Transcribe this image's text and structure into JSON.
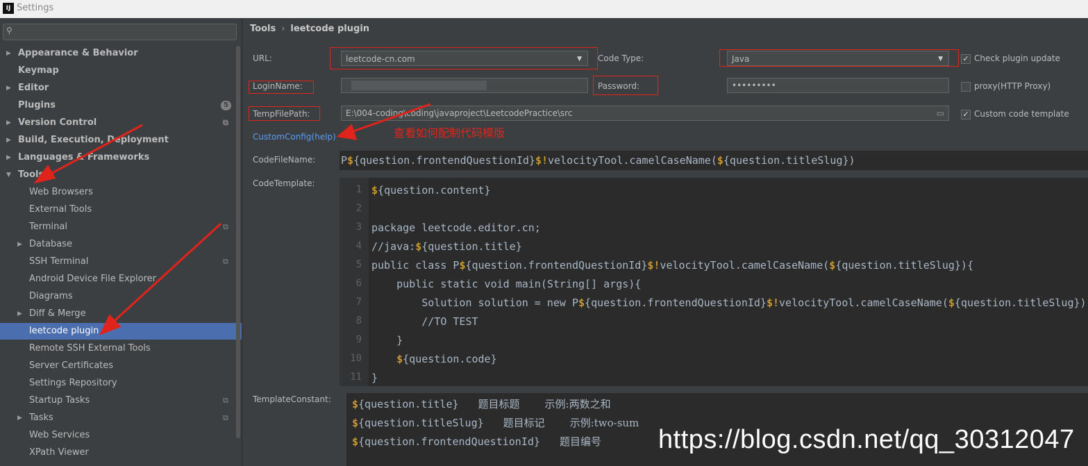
{
  "window": {
    "title": "Settings",
    "logo": "IJ"
  },
  "search": {
    "placeholder": ""
  },
  "tree": [
    {
      "label": "Appearance & Behavior",
      "bold": true,
      "arrow": "right"
    },
    {
      "label": "Keymap",
      "bold": true,
      "arrow": ""
    },
    {
      "label": "Editor",
      "bold": true,
      "arrow": "right"
    },
    {
      "label": "Plugins",
      "bold": true,
      "arrow": "",
      "badge": "5"
    },
    {
      "label": "Version Control",
      "bold": true,
      "arrow": "right",
      "project": true
    },
    {
      "label": "Build, Execution, Deployment",
      "bold": true,
      "arrow": "right"
    },
    {
      "label": "Languages & Frameworks",
      "bold": true,
      "arrow": "right"
    },
    {
      "label": "Tools",
      "bold": true,
      "arrow": "down"
    },
    {
      "label": "Web Browsers",
      "indent": true
    },
    {
      "label": "External Tools",
      "indent": true
    },
    {
      "label": "Terminal",
      "indent": true,
      "project": true
    },
    {
      "label": "Database",
      "indent": true,
      "arrow": "right"
    },
    {
      "label": "SSH Terminal",
      "indent": true,
      "project": true
    },
    {
      "label": "Android Device File Explorer",
      "indent": true
    },
    {
      "label": "Diagrams",
      "indent": true
    },
    {
      "label": "Diff & Merge",
      "indent": true,
      "arrow": "right"
    },
    {
      "label": "leetcode plugin",
      "indent": true,
      "selected": true
    },
    {
      "label": "Remote SSH External Tools",
      "indent": true
    },
    {
      "label": "Server Certificates",
      "indent": true
    },
    {
      "label": "Settings Repository",
      "indent": true
    },
    {
      "label": "Startup Tasks",
      "indent": true,
      "project": true
    },
    {
      "label": "Tasks",
      "indent": true,
      "arrow": "right",
      "project": true
    },
    {
      "label": "Web Services",
      "indent": true
    },
    {
      "label": "XPath Viewer",
      "indent": true
    }
  ],
  "breadcrumb": {
    "parent": "Tools",
    "separator": "›",
    "current": "leetcode plugin"
  },
  "form": {
    "url_label": "URL:",
    "url_value": "leetcode-cn.com",
    "code_type_label": "Code Type:",
    "code_type_value": "Java",
    "check_update_label": "Check plugin update",
    "login_label": "LoginName:",
    "login_value": "",
    "password_label": "Password:",
    "password_value": "•••••••••",
    "proxy_label": "proxy(HTTP Proxy)",
    "temp_label": "TempFilePath:",
    "temp_value": "E:\\004-coding\\coding\\javaproject\\LeetcodePractice\\src",
    "custom_template_label": "Custom code template",
    "custom_config_link": "CustomConfig(help)",
    "annotation": "查看如何配制代码模版",
    "codefile_label": "CodeFileName:",
    "codefile_value": "P${question.frontendQuestionId}$!velocityTool.camelCaseName(${question.titleSlug})",
    "codetemplate_label": "CodeTemplate:",
    "template_constant_label": "TemplateConstant:"
  },
  "code_lines": [
    "${question.content}",
    "",
    "package leetcode.editor.cn;",
    "//java:${question.title}",
    "public class P${question.frontendQuestionId}$!velocityTool.camelCaseName(${question.titleSlug}){",
    "    public static void main(String[] args){",
    "        Solution solution = new P${question.frontendQuestionId}$!velocityTool.camelCaseName(${question.titleSlug})(",
    "        //TO TEST",
    "    }",
    "    ${question.code}",
    "}"
  ],
  "template_constants": [
    {
      "var": "${question.title}",
      "desc": "题目标题",
      "example": "示例:两数之和"
    },
    {
      "var": "${question.titleSlug}",
      "desc": "题目标记",
      "example": "示例:two-sum"
    },
    {
      "var": "${question.frontendQuestionId}",
      "desc": "题目编号",
      "example": ""
    }
  ],
  "watermark": "https://blog.csdn.net/qq_30312047",
  "colors": {
    "background": "#3c3f41",
    "editor": "#2b2b2b",
    "selection": "#4b6eaf",
    "annotation_red": "#e0241c",
    "link": "#589df6",
    "dollar": "#cc9a2c"
  }
}
